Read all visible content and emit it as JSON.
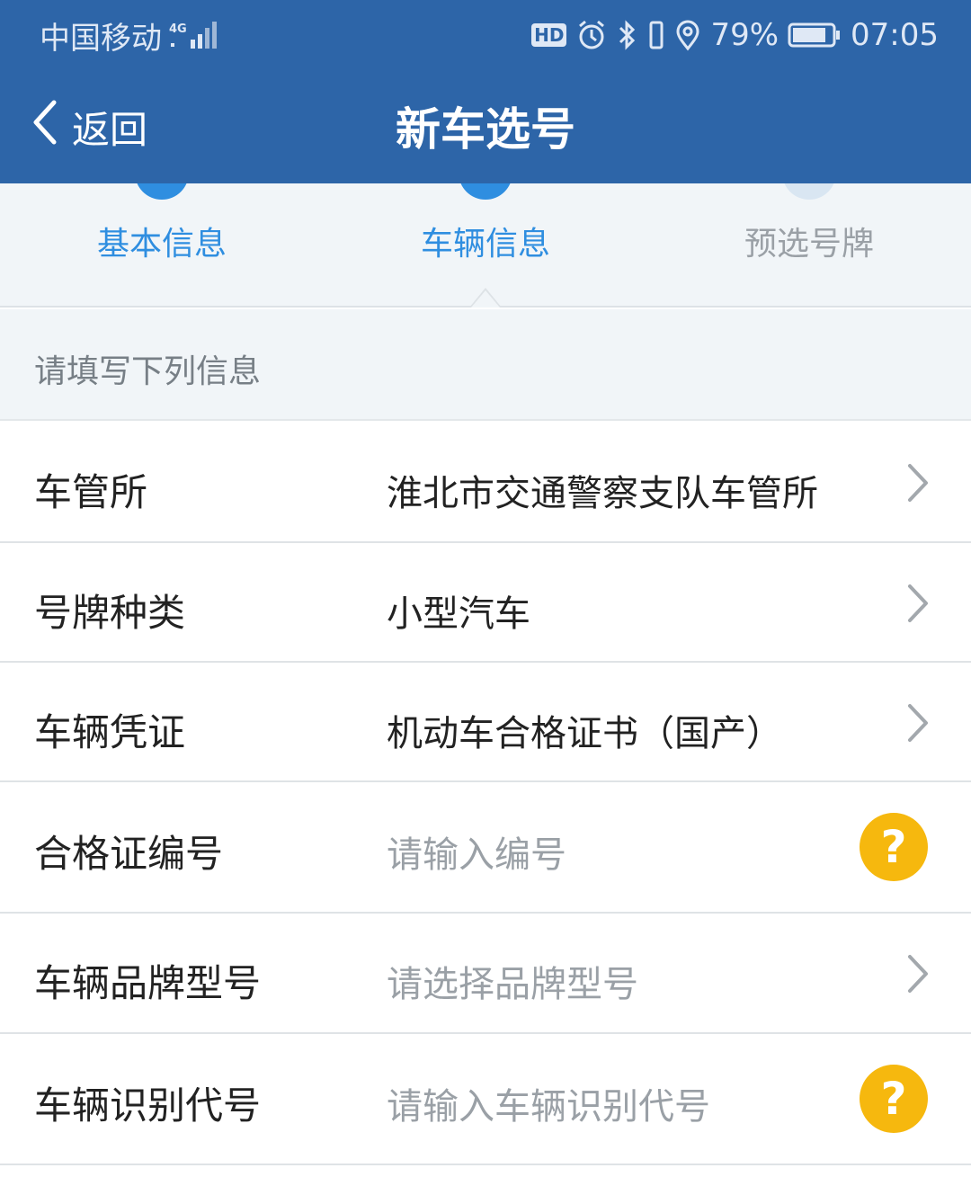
{
  "status_bar": {
    "carrier": "中国移动",
    "network": "4G",
    "battery_percent": "79%",
    "time": "07:05"
  },
  "nav": {
    "back_label": "返回",
    "title": "新车选号"
  },
  "steps": [
    {
      "label": "基本信息",
      "state": "done"
    },
    {
      "label": "车辆信息",
      "state": "active"
    },
    {
      "label": "预选号牌",
      "state": "pending"
    }
  ],
  "section_hint": "请填写下列信息",
  "form": {
    "rows": [
      {
        "label": "车管所",
        "value": "淮北市交通警察支队车管所",
        "control": "chevron-right-icon"
      },
      {
        "label": "号牌种类",
        "value": "小型汽车",
        "control": "chevron-right-icon"
      },
      {
        "label": "车辆凭证",
        "value": "机动车合格证书（国产）",
        "control": "chevron-right-icon"
      },
      {
        "label": "合格证编号",
        "placeholder": "请输入编号",
        "control": "help-icon",
        "help_text": "?"
      },
      {
        "label": "车辆品牌型号",
        "placeholder": "请选择品牌型号",
        "control": "chevron-right-icon"
      },
      {
        "label": "车辆识别代号",
        "placeholder": "请输入车辆识别代号",
        "control": "help-icon",
        "help_text": "?"
      }
    ]
  },
  "colors": {
    "header_blue": "#2d65a8",
    "step_active_blue": "#2f8ee0",
    "step_pending": "#d9e6f2",
    "help_yellow": "#f6b80e"
  }
}
